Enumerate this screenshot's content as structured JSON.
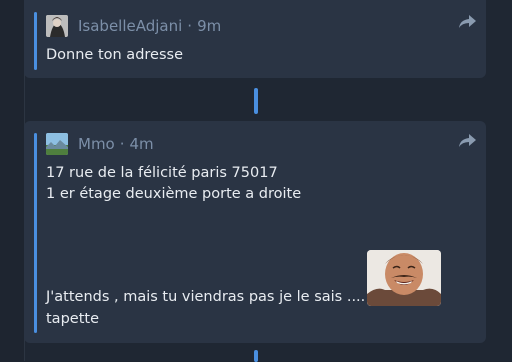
{
  "colors": {
    "background": "#1e2530",
    "card": "#2a3444",
    "accent": "#4a8fe0",
    "meta_text": "#7c8fa8",
    "body_text": "#e8ecf1"
  },
  "messages": [
    {
      "username": "IsabelleAdjani",
      "separator": "·",
      "time": "9m",
      "avatar": "user-avatar-photo",
      "lines": [
        "Donne ton adresse"
      ],
      "action_icon": "share-forward-icon"
    },
    {
      "username": "Mmo",
      "separator": "·",
      "time": "4m",
      "avatar": "user-avatar-landscape",
      "lines": [
        "17 rue de la félicité paris 75017",
        "1 er étage deuxième porte a droite",
        "J'attends , mais tu viendras pas je le sais ....",
        "tapette"
      ],
      "sticker": "laughing-man-sticker",
      "action_icon": "share-forward-icon"
    }
  ]
}
